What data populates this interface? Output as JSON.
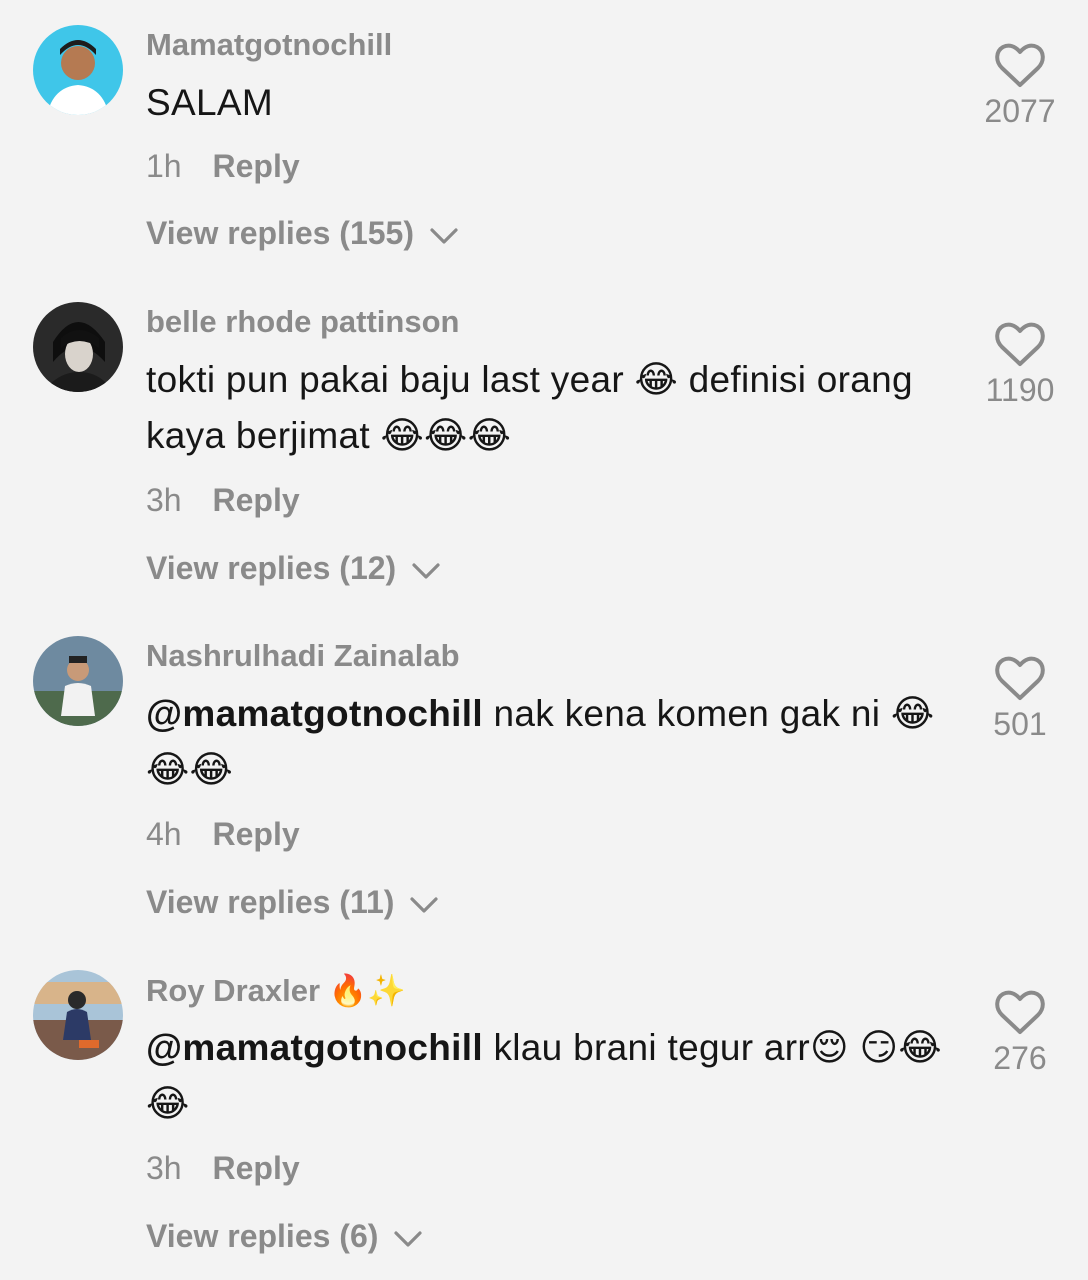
{
  "comments": [
    {
      "username": "Mamatgotnochill",
      "username_emoji": "",
      "mention": "",
      "text": "SALAM",
      "time": "1h",
      "reply_label": "Reply",
      "view_replies": "View replies (155)",
      "likes": "2077"
    },
    {
      "username": "belle rhode pattinson",
      "username_emoji": "",
      "mention": "",
      "text": "tokti pun pakai baju last year 😂 definisi orang kaya berjimat 😂😂😂",
      "time": "3h",
      "reply_label": "Reply",
      "view_replies": "View replies (12)",
      "likes": "1190"
    },
    {
      "username": "Nashrulhadi Zainalab",
      "username_emoji": "",
      "mention": "@mamatgotnochill",
      "text": " nak kena komen gak ni 😂😂😂",
      "time": "4h",
      "reply_label": "Reply",
      "view_replies": "View replies (11)",
      "likes": "501"
    },
    {
      "username": "Roy Draxler ",
      "username_emoji": "🔥✨",
      "mention": "@mamatgotnochill",
      "text": " klau brani tegur arr😌 😏😂😂",
      "time": "3h",
      "reply_label": "Reply",
      "view_replies": "View replies (6)",
      "likes": "276"
    }
  ],
  "icons": {
    "like": "heart-outline-icon",
    "expand": "chevron-down-icon"
  },
  "colors": {
    "background": "#f3f3f3",
    "secondary_text": "#8a8a8a",
    "primary_text": "#161616"
  }
}
